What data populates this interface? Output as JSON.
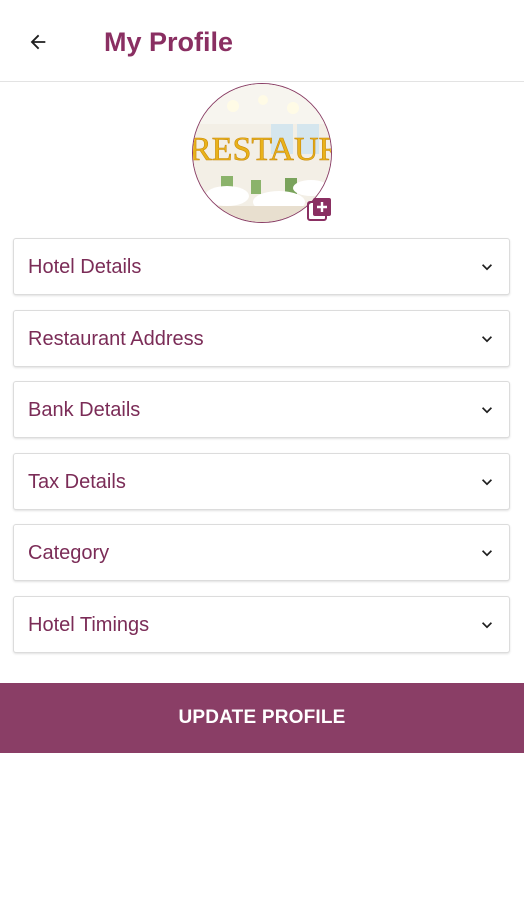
{
  "header": {
    "back_icon": "arrow-left-icon",
    "title": "My Profile"
  },
  "avatar": {
    "image_text": "RESTAURA",
    "add_icon": "add-photo-icon"
  },
  "sections": [
    {
      "label": "Hotel Details",
      "icon": "chevron-down-icon"
    },
    {
      "label": "Restaurant Address",
      "icon": "chevron-down-icon"
    },
    {
      "label": "Bank Details",
      "icon": "chevron-down-icon"
    },
    {
      "label": "Tax Details",
      "icon": "chevron-down-icon"
    },
    {
      "label": "Category",
      "icon": "chevron-down-icon"
    },
    {
      "label": "Hotel Timings",
      "icon": "chevron-down-icon"
    }
  ],
  "update_button": {
    "label": "UPDATE PROFILE"
  },
  "colors": {
    "brand": "#8a2f62",
    "button_bg": "#8a3e66",
    "label_text": "#7b2c57",
    "avatar_text": "#e9b21a"
  }
}
